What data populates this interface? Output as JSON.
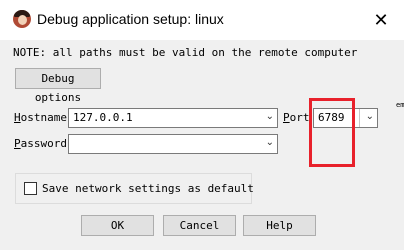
{
  "window": {
    "title": "Debug application setup: linux",
    "close_glyph": "✕",
    "icon": "app-avatar-icon"
  },
  "note": "NOTE: all paths must be valid on the remote computer",
  "debug_options_button": "Debug options",
  "hostname": {
    "label_first": "H",
    "label_rest": "ostname",
    "value": "127.0.0.1"
  },
  "port": {
    "label_first": "P",
    "label_rest": "ort",
    "value": "6789"
  },
  "password": {
    "label_first": "P",
    "label_rest": "assword",
    "value": ""
  },
  "save_settings_label": "Save network settings as default",
  "save_settings_checked": false,
  "buttons": {
    "ok": "OK",
    "cancel": "Cancel",
    "help": "Help"
  },
  "clipped_edge_text": "em",
  "dropdown_glyph": "⌄",
  "colors": {
    "highlight": "#e8212b",
    "client_bg": "#f0f0f0"
  }
}
